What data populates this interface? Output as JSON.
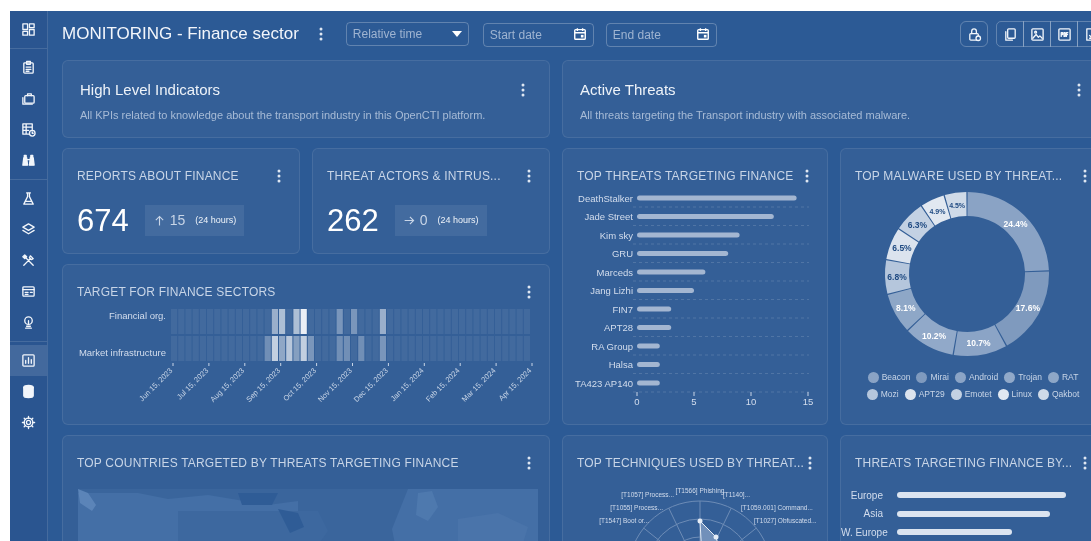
{
  "header": {
    "title": "MONITORING - Finance sector",
    "relative_time": {
      "placeholder": "Relative time"
    },
    "start_date": {
      "placeholder": "Start date"
    },
    "end_date": {
      "placeholder": "End date"
    }
  },
  "sidebar": {
    "groups": [
      [
        {
          "selected": false
        }
      ],
      [
        {
          "selected": false
        },
        {
          "selected": false
        },
        {
          "selected": false
        },
        {
          "selected": false
        }
      ],
      [
        {
          "selected": false
        },
        {
          "selected": false
        },
        {
          "selected": false
        },
        {
          "selected": false
        },
        {
          "selected": false
        }
      ],
      [
        {
          "selected": true
        },
        {
          "selected": false
        },
        {
          "selected": false
        }
      ]
    ]
  },
  "widgets": [
    {
      "kind": "text",
      "title": "High Level Indicators",
      "description": "All KPIs related to knowledge about the transport industry in this OpenCTI platform."
    },
    {
      "kind": "text",
      "title": "Active Threats",
      "description": "All threats targeting the Transport industry with associated malware."
    },
    {
      "kind": "number",
      "title": "REPORTS ABOUT FINANCE",
      "value": "674",
      "change": {
        "kind": "up",
        "value": "15"
      },
      "period": "(24 hours)"
    },
    {
      "kind": "number",
      "title": "THREAT ACTORS & INTRUS...",
      "value": "262",
      "change": {
        "kind": "flat",
        "value": "0"
      },
      "period": "(24 hours)"
    },
    {
      "kind": "bars",
      "title": "TOP THREATS TARGETING FINANCE",
      "chart_data": {
        "type": "bar",
        "orientation": "horizontal",
        "categories": [
          "DeathStalker",
          "Jade Street",
          "Kim sky",
          "GRU",
          "Marceds",
          "Jang Lizhi",
          "FIN7",
          "APT28",
          "RA Group",
          "Halsa",
          "TA423 AP140"
        ],
        "values": [
          14,
          12,
          9,
          8,
          6,
          5,
          3,
          3,
          2,
          2,
          2
        ],
        "xlim": [
          0,
          15
        ],
        "xticks": [
          0,
          5,
          10,
          15
        ]
      }
    },
    {
      "kind": "donut",
      "title": "TOP MALWARE USED BY THREAT...",
      "chart_data": {
        "type": "donut",
        "categories": [
          "Beacon",
          "Mirai",
          "Android",
          "Trojan",
          "RAT",
          "Mozi",
          "APT29",
          "Emotet",
          "Linux",
          "Qakbot"
        ],
        "values": [
          24.4,
          17.6,
          10.7,
          10.2,
          8.1,
          6.8,
          6.5,
          6.3,
          4.9,
          4.5
        ],
        "value_labels": [
          "24.4%",
          "17.6%",
          "10.7%",
          "10.2%",
          "8.1%",
          "6.8%",
          "6.5%",
          "6.3%",
          "4.9%",
          "4.5%"
        ],
        "data_labels": true
      },
      "legend": [
        {
          "color": "#8aa3c5"
        },
        {
          "color": "#7f9abe"
        },
        {
          "color": "#8ba4c6"
        },
        {
          "color": "#91a9c9"
        },
        {
          "color": "#8ea7c7"
        },
        {
          "color": "#b5c6dc"
        },
        {
          "color": "#dbe3ee"
        },
        {
          "color": "#c3d1e3"
        },
        {
          "color": "#e1e8f1"
        },
        {
          "color": "#cfdae8"
        }
      ]
    },
    {
      "kind": "heatmap",
      "title": "TARGET FOR FINANCE SECTORS",
      "rows": [
        "Financial org.",
        "Market infrastructure"
      ],
      "dates": [
        "Jun 15, 2023",
        "Jul 15, 2023",
        "Aug 15, 2023",
        "Sep 15, 2023",
        "Oct 15, 2023",
        "Nov 15, 2023",
        "Dec 15, 2023",
        "Jan 15, 2024",
        "Feb 15, 2024",
        "Mar 15, 2024",
        "Apr 15, 2024"
      ]
    },
    {
      "kind": "map",
      "title": "TOP COUNTRIES TARGETED BY THREATS TARGETING FINANCE"
    },
    {
      "kind": "radar",
      "title": "TOP TECHNIQUES USED BY THREAT...",
      "labels": [
        "[T1057] Process...",
        "[T1566] Phishing",
        "[T1140]...",
        "[T1055] Process...",
        "[T1059.001] Command...",
        "[T1547] Boot or...",
        "[T1027] Obfuscated..."
      ]
    },
    {
      "kind": "hbars",
      "title": "THREATS TARGETING FINANCE BY...",
      "bars": [
        {
          "label": "Europe"
        },
        {
          "label": "Asia"
        },
        {
          "label": "W. Europe"
        }
      ]
    }
  ]
}
